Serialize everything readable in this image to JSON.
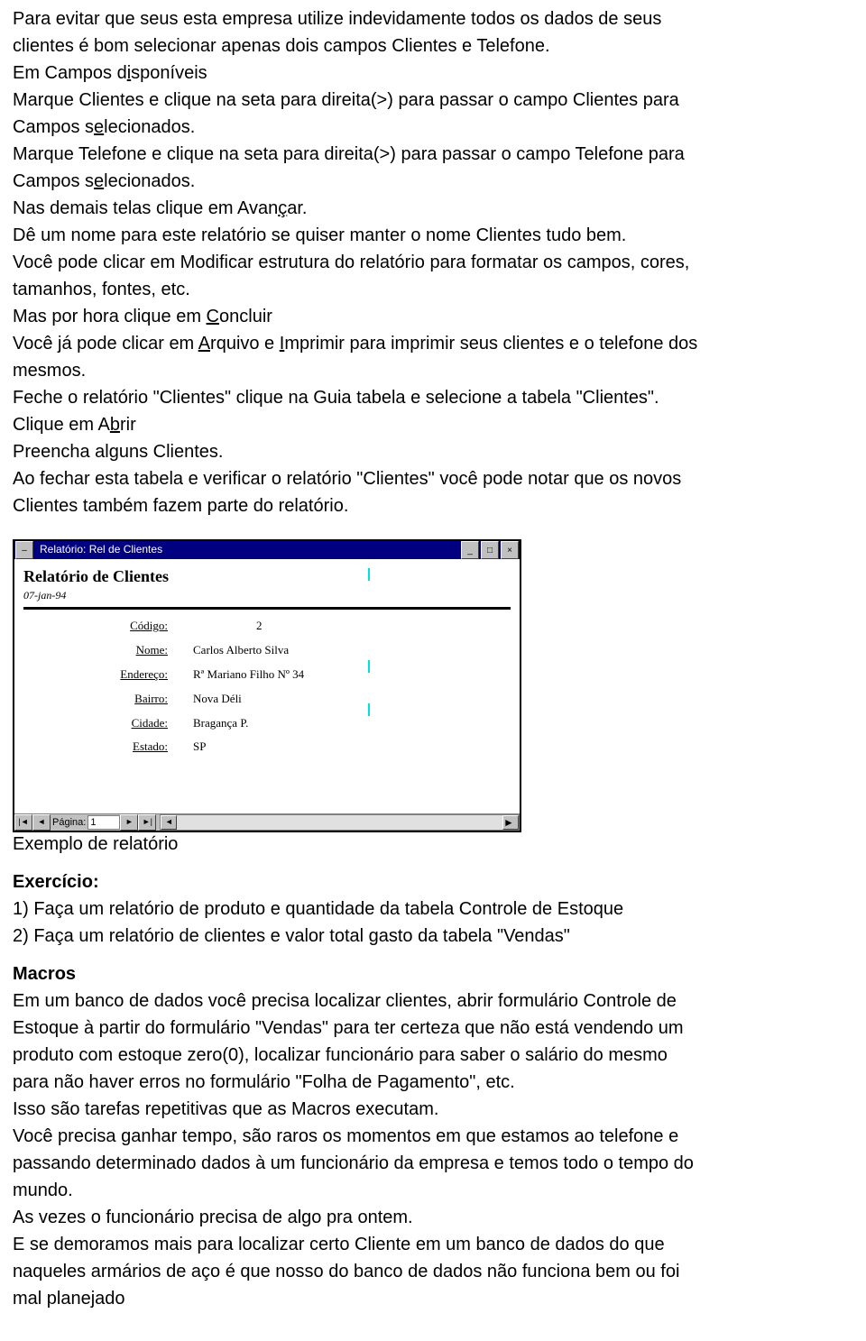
{
  "d": {
    "p1a": "Para evitar que seus esta empresa utilize indevidamente todos os dados de seus",
    "p1b": "clientes é bom selecionar apenas dois campos Clientes e Telefone.",
    "p2a": "Em Campos d",
    "p2u1": "i",
    "p2b": "sponíveis",
    "p3a": "Marque Clientes e clique na seta para direita(>) para passar o campo Clientes para",
    "p3b": "Campos s",
    "p3u": "e",
    "p3c": "lecionados.",
    "p4a": "Marque Telefone e clique na seta para direita(>) para passar o campo Telefone para",
    "p4b": "Campos s",
    "p4u": "e",
    "p4c": "lecionados.",
    "p5a": "Nas demais telas clique em Avan",
    "p5u": "ç",
    "p5b": "ar.",
    "p6": "Dê um nome para este relatório se quiser manter o nome Clientes tudo bem.",
    "p7a": "Você pode clicar em Modificar estrutura do relatório para formatar os campos, cores,",
    "p7b": "tamanhos, fontes, etc.",
    "p8a": "Mas por hora clique em ",
    "p8u": "C",
    "p8b": "oncluir",
    "p9a": "Você já pode clicar em ",
    "p9u1": "A",
    "p9b": "rquivo e ",
    "p9u2": "I",
    "p9c": "mprimir para imprimir seus clientes e o telefone dos",
    "p9d": "mesmos.",
    "p10": "Feche o relatório \"Clientes\" clique na Guia tabela e selecione a tabela \"Clientes\".",
    "p11a": "Clique em A",
    "p11u": "b",
    "p11b": "rir",
    "p12": "Preencha alguns Clientes.",
    "p13a": "Ao fechar esta tabela e verificar o relatório \"Clientes\" você pode notar que os novos",
    "p13b": "Clientes também fazem parte do relatório.",
    "cap1": "Exemplo de relatório",
    "ex_h": "Exercício:",
    "ex1": "1) Faça um relatório de produto e quantidade da  tabela Controle de Estoque",
    "ex2": "2) Faça um relatório de clientes e valor total gasto da tabela \"Vendas\"",
    "mac_h": "Macros",
    "m1a": "Em um banco de dados você precisa localizar clientes, abrir formulário Controle de",
    "m1b": "Estoque à partir do formulário \"Vendas\" para ter certeza que não está vendendo um",
    "m1c": "produto com estoque zero(0), localizar funcionário para saber o salário do  mesmo",
    "m1d": "para não haver erros no formulário \"Folha de Pagamento\", etc.",
    "m2": "Isso são tarefas repetitivas que as Macros executam.",
    "m3a": "Você precisa ganhar tempo, são raros os momentos em que estamos ao telefone e",
    "m3b": "passando determinado dados à um funcionário da empresa e temos todo o tempo do",
    "m3c": "mundo.",
    "m4": "As vezes o funcionário precisa de algo pra ontem.",
    "m5a": "E se demoramos mais para localizar certo Cliente em um banco de dados do que",
    "m5b": "naqueles armários de aço é que nosso do banco de dados não funciona bem ou foi",
    "m5c": "mal planejado"
  },
  "report": {
    "wintitle": "Relatório: Rel de Clientes",
    "title": "Relatório de Clientes",
    "date": "07-jan-94",
    "labels": {
      "codigo": "Código:",
      "nome": "Nome:",
      "endereco": "Endereço:",
      "bairro": "Bairro:",
      "cidade": "Cidade:",
      "estado": "Estado:"
    },
    "values": {
      "codigo": "2",
      "nome": "Carlos Alberto Silva",
      "endereco": "Rª Mariano Filho Nº 34",
      "bairro": "Nova Déli",
      "cidade": "Bragança P.",
      "estado": "SP"
    },
    "pagelabel": "Página:",
    "pagenum": "1"
  },
  "icons": {
    "sys": "–",
    "min": "_",
    "max": "□",
    "close": "×",
    "first": "|◄",
    "prev": "◄",
    "next": "►",
    "last": "►|",
    "larrow": "◄",
    "rarrow": "►"
  }
}
